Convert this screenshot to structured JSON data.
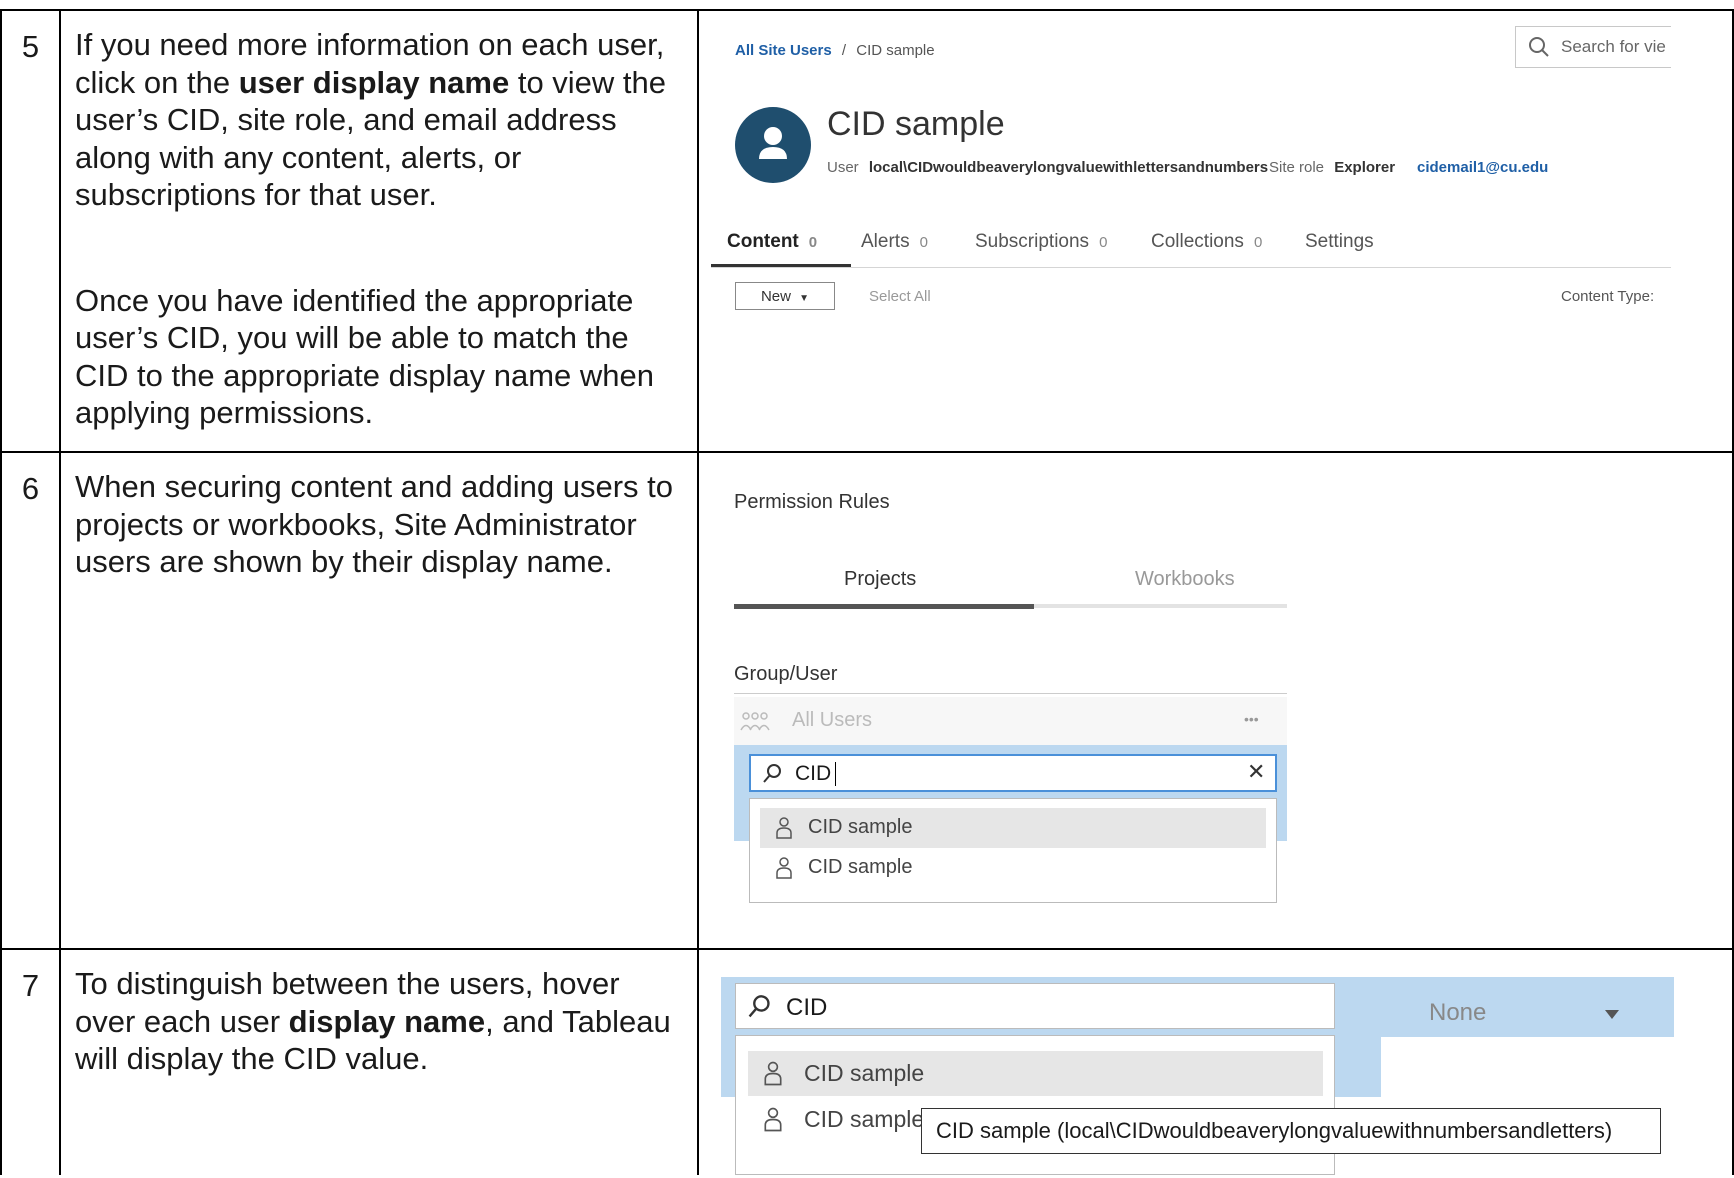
{
  "rows": [
    {
      "step": "5",
      "para1": {
        "before": "If you need more information on each user, click on the ",
        "bold": "user display name",
        "after": " to view the user’s CID, site role, and email address along with any content, alerts, or subscriptions for that user."
      },
      "para2": "Once you have identified the appropriate user’s CID, you will be able to match the CID to the appropriate display name when applying permissions.",
      "screenshot": {
        "breadcrumb_link": "All Site Users",
        "breadcrumb_sep": "/",
        "breadcrumb_current": "CID sample",
        "search_placeholder": "Search for vie",
        "user_display_name": "CID sample",
        "user_label": "User",
        "user_value": "local\\CIDwouldbeaverylongvaluewithlettersandnumbers",
        "site_role_label": "Site role",
        "site_role_value": "Explorer",
        "email": "cidemail1@cu.edu",
        "tabs": [
          {
            "label": "Content",
            "count": "0"
          },
          {
            "label": "Alerts",
            "count": "0"
          },
          {
            "label": "Subscriptions",
            "count": "0"
          },
          {
            "label": "Collections",
            "count": "0"
          },
          {
            "label": "Settings",
            "count": ""
          }
        ],
        "new_button": "New",
        "select_all": "Select All",
        "content_type_label": "Content Type:"
      }
    },
    {
      "step": "6",
      "para1": "When securing content and adding users to projects or workbooks, Site Administrator users are shown by their display name.",
      "screenshot": {
        "title": "Permission Rules",
        "tabs": [
          "Projects",
          "Workbooks"
        ],
        "group_user_label": "Group/User",
        "all_users": "All Users",
        "more_menu": "•••",
        "search_value": "CID",
        "results": [
          "CID sample",
          "CID sample"
        ]
      }
    },
    {
      "step": "7",
      "para1": {
        "before": "To distinguish between the users, hover over each user ",
        "bold": "display name",
        "after": ", and Tableau will display the CID value."
      },
      "screenshot": {
        "search_value": "CID",
        "capability_value": "None",
        "results": [
          "CID sample",
          "CID sample"
        ],
        "tooltip": "CID sample (local\\CIDwouldbeaverylongvaluewithnumbersandletters)"
      }
    }
  ],
  "colors": {
    "link_blue": "#1f5fa6",
    "avatar": "#1f4e6e",
    "selection_band": "#bcd8f0",
    "focus_border": "#4a90d9"
  }
}
